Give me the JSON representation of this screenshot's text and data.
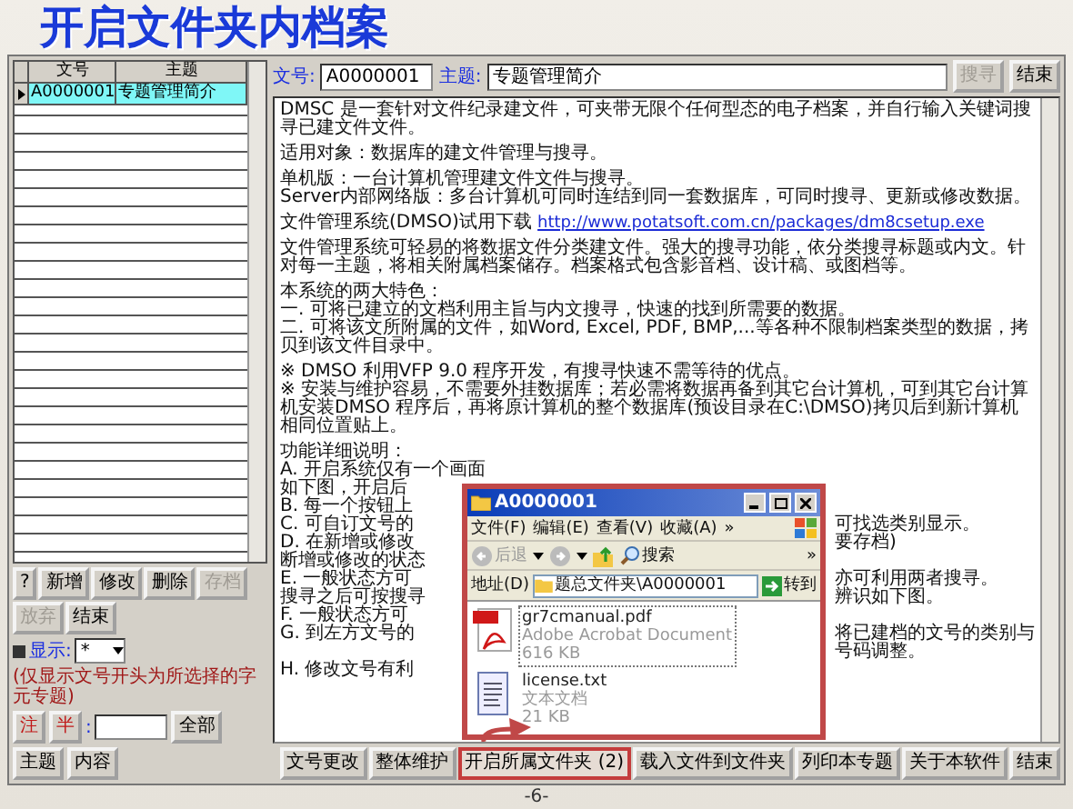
{
  "slide_title": "开启文件夹内档案",
  "left_panel": {
    "columns": [
      "文号",
      "主题"
    ],
    "rows": [
      {
        "cells": [
          "A0000001",
          "专题管理简介"
        ],
        "selected": true
      }
    ],
    "buttons": [
      {
        "label": "?",
        "disabled": false
      },
      {
        "label": "新增",
        "disabled": false
      },
      {
        "label": "修改",
        "disabled": false
      },
      {
        "label": "删除",
        "disabled": false
      },
      {
        "label": "存档",
        "disabled": true
      },
      {
        "label": "放弃",
        "disabled": true
      },
      {
        "label": "结束",
        "disabled": false
      }
    ],
    "filter": {
      "label": "显示:",
      "value": "*",
      "note": "(仅显示文号开头为所选择的字元专题)"
    },
    "search": {
      "mode_buttons": [
        "注",
        "半"
      ],
      "colon": ":",
      "buttons": [
        "全部",
        "主题",
        "内容"
      ]
    }
  },
  "right_panel": {
    "doc_label": "文号:",
    "doc_value": "A0000001",
    "subject_label": "主题:",
    "subject_value": "专题管理简介",
    "search_button": {
      "label": "搜寻",
      "disabled": true
    },
    "end_button": "结束",
    "memo": [
      {
        "kind": "text",
        "text": "DMSC 是一套针对文件纪录建文件，可夹带无限个任何型态的电子档案，并自行输入关键词搜寻已建文件文件。"
      },
      {
        "kind": "blank"
      },
      {
        "kind": "text",
        "text": "适用对象：数据库的建文件管理与搜寻。"
      },
      {
        "kind": "blank"
      },
      {
        "kind": "text",
        "text": "单机版：一台计算机管理建文件文件与搜寻。"
      },
      {
        "kind": "text",
        "text": "Server内部网络版：多台计算机可同时连结到同一套数据库，可同时搜寻、更新或修改数据。"
      },
      {
        "kind": "blank"
      },
      {
        "kind": "link",
        "text": "文件管理系统(DMSO)试用下载",
        "url": "http://www.potatsoft.com.cn/packages/dm8csetup.exe"
      },
      {
        "kind": "blank"
      },
      {
        "kind": "text",
        "text": "文件管理系统可轻易的将数据文件分类建文件。强大的搜寻功能，依分类搜寻标题或内文。针对每一主题，将相关附属档案储存。档案格式包含影音档、设计稿、或图档等。"
      },
      {
        "kind": "blank"
      },
      {
        "kind": "text",
        "text": "本系统的两大特色："
      },
      {
        "kind": "text",
        "text": "一. 可将已建立的文档利用主旨与内文搜寻，快速的找到所需要的数据。"
      },
      {
        "kind": "text",
        "text": "二. 可将该文所附属的文件，如Word, Excel, PDF, BMP,...等各种不限制档案类型的数据，拷贝到该文件目录中。"
      },
      {
        "kind": "blank"
      },
      {
        "kind": "text",
        "text": "※ DMSO 利用VFP 9.0 程序开发，有搜寻快速不需等待的优点。"
      },
      {
        "kind": "text",
        "text": "※ 安装与维护容易，不需要外挂数据库；若必需将数据再备到其它台计算机，可到其它台计算机安装DMSO 程序后，再将原计算机的整个数据库(预设目录在C:\\DMSO)拷贝后到新计算机相同位置贴上。"
      },
      {
        "kind": "blank"
      },
      {
        "kind": "text",
        "text": "功能详细说明："
      },
      {
        "kind": "text",
        "text": "A. 开启系统仅有一个画面"
      },
      {
        "kind": "split",
        "left": "如下图，开启后"
      },
      {
        "kind": "split",
        "left": "B. 每一个按钮上"
      },
      {
        "kind": "split",
        "left": "C. 可自订文号的",
        "right": "可找选类别显示。"
      },
      {
        "kind": "split",
        "left": "D. 在新增或修改",
        "right": "要存档)"
      },
      {
        "kind": "split",
        "left": "断增或修改的状态"
      },
      {
        "kind": "split",
        "left": "E. 一般状态方可",
        "right": "亦可利用两者搜寻。"
      },
      {
        "kind": "split",
        "left": "搜寻之后可按搜寻",
        "right": "辨识如下图。"
      },
      {
        "kind": "split",
        "left": "F. 一般状态方可"
      },
      {
        "kind": "split",
        "left": "G. 到左方文号的",
        "right": "将已建档的文号的类别与号码调整。"
      },
      {
        "kind": "split",
        "left": "H. 修改文号有利"
      }
    ],
    "bottom_buttons": [
      {
        "label": "文号更改",
        "highlighted": false
      },
      {
        "label": "整体维护",
        "highlighted": false
      },
      {
        "label": "开启所属文件夹 (2)",
        "highlighted": true
      },
      {
        "label": "载入文件到文件夹",
        "highlighted": false
      },
      {
        "label": "列印本专题",
        "highlighted": false
      },
      {
        "label": "关于本软件",
        "highlighted": false
      },
      {
        "label": "结束",
        "highlighted": false
      }
    ]
  },
  "explorer": {
    "title": "A0000001",
    "menu": [
      "文件(F)",
      "编辑(E)",
      "查看(V)",
      "收藏(A)",
      "»"
    ],
    "toolbar": {
      "back": "后退",
      "search": "搜索",
      "more": "»"
    },
    "address": {
      "label": "地址(D)",
      "value": "题总文件夹\\A0000001",
      "go": "转到"
    },
    "files": [
      {
        "kind": "pdf",
        "name": "gr7cmanual.pdf",
        "type": "Adobe Acrobat Document",
        "size": "616 KB",
        "selected": true
      },
      {
        "kind": "txt",
        "name": "license.txt",
        "type": "文本文档",
        "size": "21 KB",
        "selected": false
      }
    ]
  },
  "page_number": "-6-"
}
